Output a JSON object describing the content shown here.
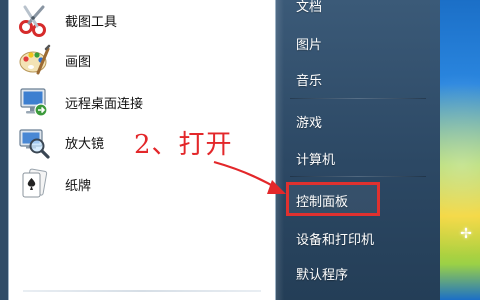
{
  "left_pane": {
    "items": [
      {
        "label": "截图工具",
        "icon": "snipping-tool-icon"
      },
      {
        "label": "画图",
        "icon": "paint-icon"
      },
      {
        "label": "远程桌面连接",
        "icon": "remote-desktop-icon"
      },
      {
        "label": "放大镜",
        "icon": "magnifier-icon"
      },
      {
        "label": "纸牌",
        "icon": "solitaire-icon"
      }
    ]
  },
  "right_pane": {
    "items": [
      {
        "label": "文档"
      },
      {
        "label": "图片"
      },
      {
        "label": "音乐"
      },
      {
        "label": "游戏"
      },
      {
        "label": "计算机"
      },
      {
        "label": "控制面板"
      },
      {
        "label": "设备和打印机"
      },
      {
        "label": "默认程序"
      }
    ]
  },
  "annotation": {
    "text": "2、打开",
    "color": "#e3272a"
  },
  "colors": {
    "highlight_border": "#e0312f",
    "right_pane": "#2f4c67"
  }
}
